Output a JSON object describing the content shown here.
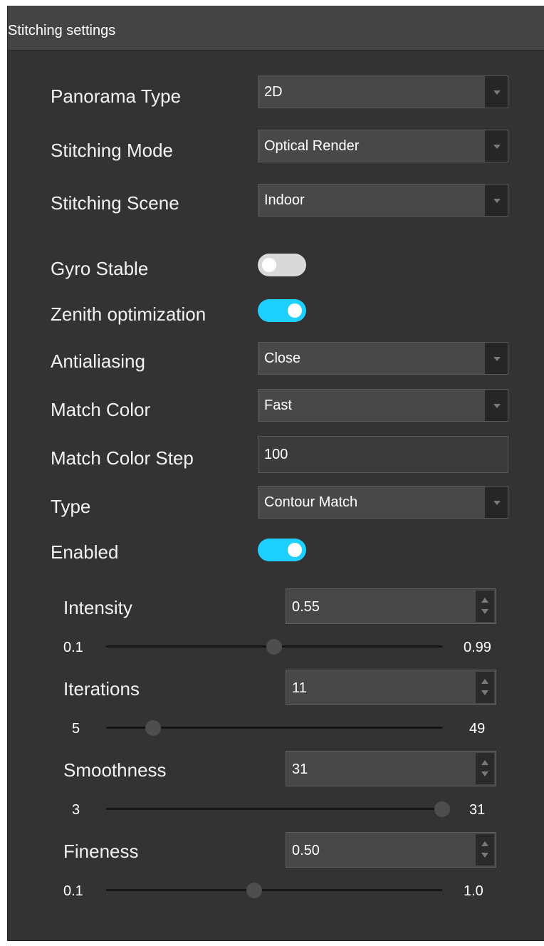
{
  "header": {
    "title": "Stitching settings"
  },
  "settings": {
    "panorama_type": {
      "label": "Panorama Type",
      "value": "2D"
    },
    "stitching_mode": {
      "label": "Stitching Mode",
      "value": "Optical Render"
    },
    "stitching_scene": {
      "label": "Stitching Scene",
      "value": "Indoor"
    },
    "gyro_stable": {
      "label": "Gyro Stable",
      "on": false
    },
    "zenith_optimization": {
      "label": "Zenith optimization",
      "on": true
    },
    "antialiasing": {
      "label": "Antialiasing",
      "value": "Close"
    },
    "match_color": {
      "label": "Match Color",
      "value": "Fast"
    },
    "match_color_step": {
      "label": "Match Color Step",
      "value": "100"
    },
    "type": {
      "label": "Type",
      "value": "Contour Match"
    },
    "enabled": {
      "label": "Enabled",
      "on": true
    }
  },
  "params": {
    "intensity": {
      "label": "Intensity",
      "value": "0.55",
      "min": "0.1",
      "max": "0.99",
      "fraction": 0.5
    },
    "iterations": {
      "label": "Iterations",
      "value": "11",
      "min": "5",
      "max": "49",
      "fraction": 0.14
    },
    "smoothness": {
      "label": "Smoothness",
      "value": "31",
      "min": "3",
      "max": "31",
      "fraction": 1.0
    },
    "fineness": {
      "label": "Fineness",
      "value": "0.50",
      "min": "0.1",
      "max": "1.0",
      "fraction": 0.44
    }
  },
  "colors": {
    "toggle_on": "#1ccfff",
    "toggle_off": "#d9d9d9",
    "panel_bg": "#333333"
  }
}
